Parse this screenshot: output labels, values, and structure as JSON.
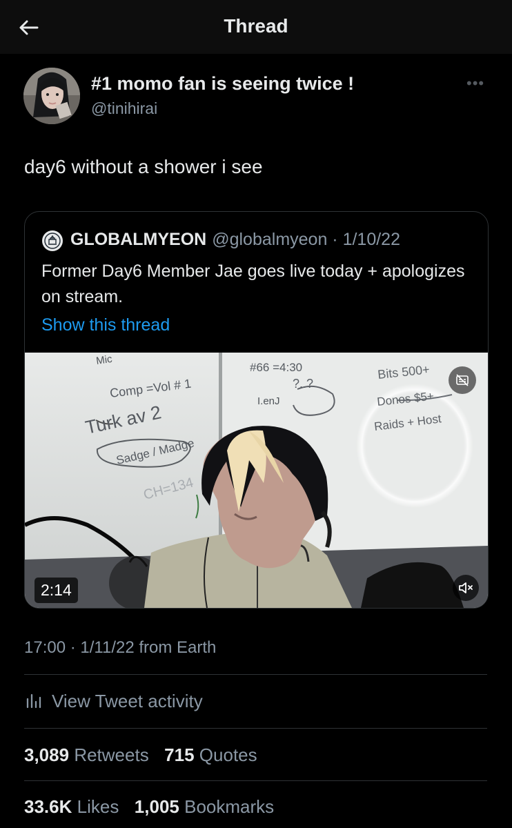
{
  "header": {
    "title": "Thread",
    "back_icon": "arrow-left-icon"
  },
  "tweet": {
    "author_name": "#1 momo fan is seeing twice !",
    "author_handle": "@tinihirai",
    "text": "day6 without a shower i see",
    "timestamp": "17:00 · 1/11/22 from Earth",
    "activity_label": "View Tweet activity",
    "stats": {
      "retweets": "3,089",
      "retweets_label": "Retweets",
      "quotes": "715",
      "quotes_label": "Quotes",
      "likes": "33.6K",
      "likes_label": "Likes",
      "bookmarks": "1,005",
      "bookmarks_label": "Bookmarks"
    }
  },
  "quoted": {
    "name": "GLOBALMYEON",
    "meta": "@globalmyeon · 1/10/22",
    "text": "Former Day6 Member Jae goes live today + apologizes on stream.",
    "link": "Show this thread",
    "media": {
      "duration": "2:14",
      "whiteboard_text": {
        "left_1": "Mic",
        "left_2": "Comp =Vol # 1",
        "left_3": "Turk av 2",
        "left_4": "Sadge / Madge",
        "left_5": "CH=134",
        "top_center": "#66 =4:30",
        "center_2": "?..?",
        "center_3": "I.enJ",
        "right_1": "Bits 500+",
        "right_2": "Donos $5+",
        "right_3": "Raids + Host"
      }
    }
  },
  "colors": {
    "accent": "#1d9bf0",
    "background": "#000000",
    "secondary_text": "#8b98a5"
  }
}
